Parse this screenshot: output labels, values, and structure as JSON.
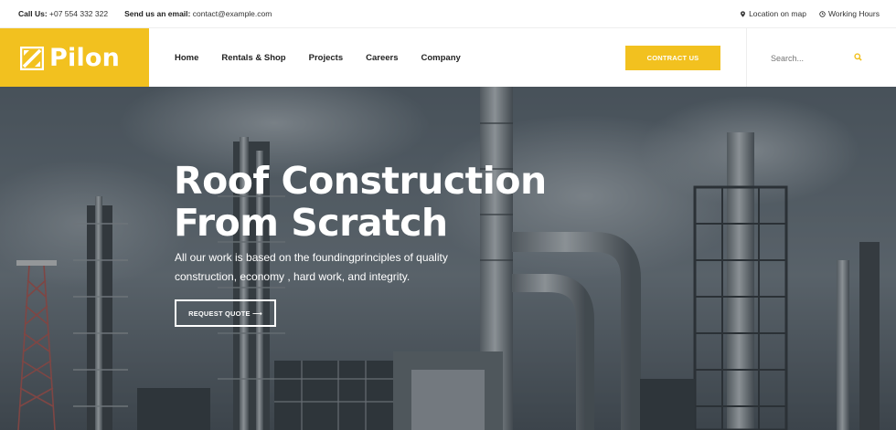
{
  "topbar": {
    "call_label": "Call Us:",
    "call_value": "+07 554 332 322",
    "email_label": "Send us an email:",
    "email_value": "contact@example.com",
    "location": "Location on map",
    "hours": "Working Hours"
  },
  "header": {
    "logo_text": "Pilon",
    "nav": [
      "Home",
      "Rentals & Shop",
      "Projects",
      "Careers",
      "Company"
    ],
    "cta_label": "CONTRACT US",
    "search_placeholder": "Search..."
  },
  "hero": {
    "title_line1": "Roof Construction",
    "title_line2": "From Scratch",
    "subtitle": "All our work is based on the foundingprinciples of quality construction, economy , hard work, and integrity.",
    "button_label": "REQUEST QUOTE ⟶"
  },
  "colors": {
    "accent": "#f2c11f",
    "text_dark": "#222222",
    "hero_overlay": "#3e464f"
  }
}
